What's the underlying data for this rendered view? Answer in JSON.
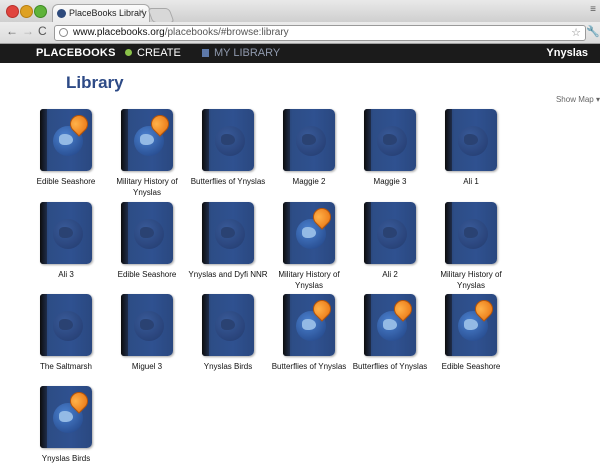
{
  "browser": {
    "tab_title": "PlaceBooks Library",
    "tab_close": "×",
    "url_host": "www.placebooks.org",
    "url_path": "/placebooks/#browse:library",
    "back": "←",
    "forward": "→",
    "reload": "C",
    "star": "☆",
    "menu": "≡",
    "wrench": "🔧"
  },
  "nav": {
    "brand": "PLACEBOOKS",
    "create": "CREATE",
    "my_library": "MY LIBRARY",
    "user": "Ynyslas"
  },
  "page": {
    "title": "Library",
    "show_map": "Show Map ▾"
  },
  "books": [
    {
      "label": "Edible Seashore",
      "published": true
    },
    {
      "label": "Military History of Ynyslas",
      "published": true
    },
    {
      "label": "Butterflies of Ynyslas",
      "published": false
    },
    {
      "label": "Maggie 2",
      "published": false
    },
    {
      "label": "Maggie 3",
      "published": false
    },
    {
      "label": "Ali 1",
      "published": false
    },
    {
      "label": "Ali 3",
      "published": false
    },
    {
      "label": "Edible Seashore",
      "published": false
    },
    {
      "label": "Ynyslas and Dyfi NNR",
      "published": false
    },
    {
      "label": "Military History of Ynyslas",
      "published": true
    },
    {
      "label": "Ali 2",
      "published": false
    },
    {
      "label": "Military History of Ynyslas",
      "published": false
    },
    {
      "label": "The Saltmarsh",
      "published": false
    },
    {
      "label": "Miguel 3",
      "published": false
    },
    {
      "label": "Ynyslas Birds",
      "published": false
    },
    {
      "label": "Butterflies of Ynyslas",
      "published": true
    },
    {
      "label": "Butterflies of Ynyslas",
      "published": true
    },
    {
      "label": "Edible Seashore",
      "published": true
    },
    {
      "label": "Ynyslas Birds",
      "published": true
    }
  ]
}
